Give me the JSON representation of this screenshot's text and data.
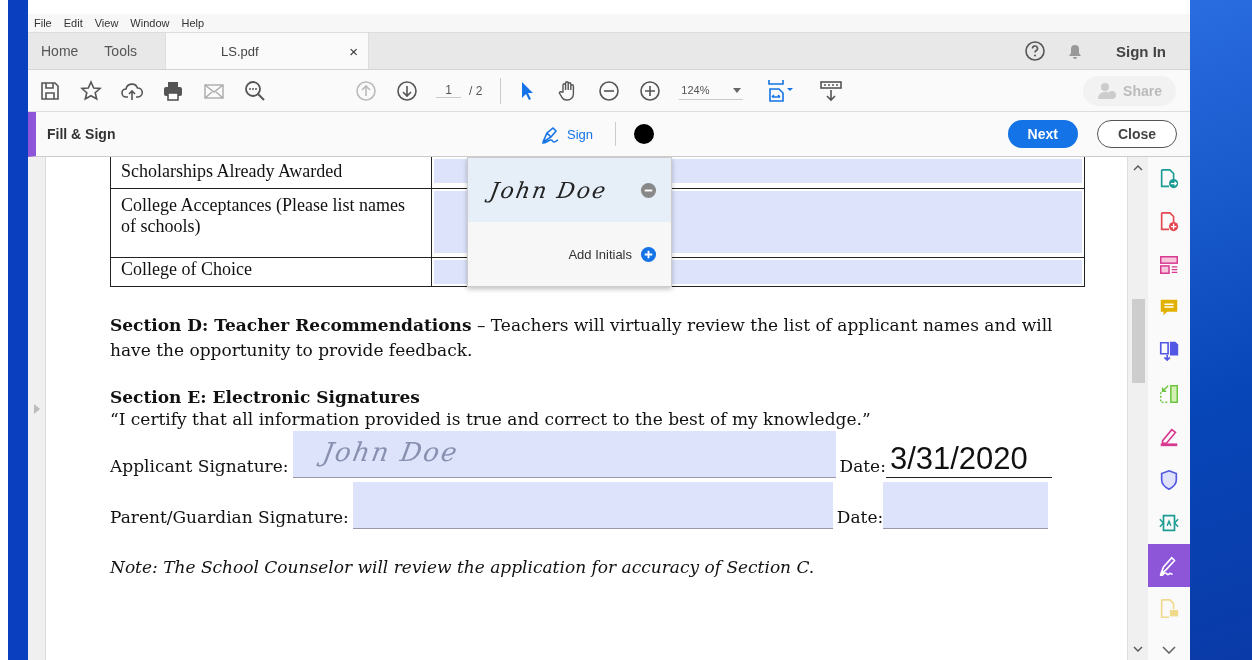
{
  "menu": [
    "File",
    "Edit",
    "View",
    "Window",
    "Help"
  ],
  "tabs": [
    {
      "label": "Home",
      "selected": false
    },
    {
      "label": "Tools",
      "selected": false
    },
    {
      "label": "LS.pdf",
      "selected": true,
      "close": "×"
    }
  ],
  "sign_in": "Sign In",
  "toolbar": {
    "page": "1",
    "page_total": "/ 2",
    "zoom": "124%",
    "share": "Share"
  },
  "fill_sign": {
    "title": "Fill & Sign",
    "sign": "Sign",
    "next": "Next",
    "close": "Close"
  },
  "signature_menu": {
    "signature": "John Doe",
    "add_initials": "Add Initials"
  },
  "document": {
    "table_rows": [
      {
        "label": "Scholarships Already Awarded"
      },
      {
        "label": "College Acceptances (Please list names of schools)"
      },
      {
        "label": "College of Choice"
      }
    ],
    "section_d": "**Section D: Teacher Recommendations** – Teachers will virtually review the list of applicant names and will have the opportunity to provide feedback.",
    "section_e_heading": "Section E: Electronic Signatures",
    "certify": "“I certify that all information provided is true and correct to the best of my knowledge.”",
    "signature_lines": [
      {
        "label": "Applicant Signature:",
        "signature": "John Doe",
        "date_label": "Date:",
        "date": "3/31/2020"
      },
      {
        "label": "Parent/Guardian Signature:",
        "date_label": "Date:"
      }
    ],
    "note": "Note: The School Counselor will review the application for accuracy of Section C."
  },
  "tools_panel": [
    {
      "kind": "export",
      "selected": false
    },
    {
      "kind": "create",
      "selected": false
    },
    {
      "kind": "organize",
      "selected": false
    },
    {
      "kind": "comment",
      "selected": false
    },
    {
      "kind": "combine",
      "selected": false
    },
    {
      "kind": "resize",
      "selected": false
    },
    {
      "kind": "highlight",
      "selected": false
    },
    {
      "kind": "protect",
      "selected": false
    },
    {
      "kind": "compress",
      "selected": false
    },
    {
      "kind": "sign",
      "selected": true
    },
    {
      "kind": "send",
      "selected": false
    }
  ]
}
